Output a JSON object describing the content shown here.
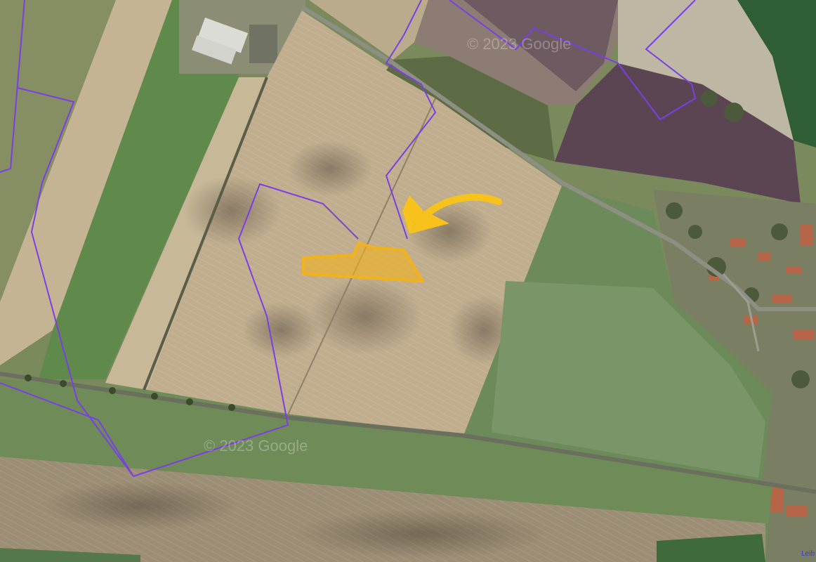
{
  "map": {
    "type": "satellite",
    "watermarks": [
      "© 2023 Google",
      "© 2023 Google"
    ],
    "corner_label": "Leib"
  },
  "overlays": {
    "boundary_color": "#7b3fe4",
    "highlight_color": "#f2b21b",
    "arrow_color": "#f7c21c"
  },
  "icons": {
    "arrow": "curved-arrow-icon"
  }
}
